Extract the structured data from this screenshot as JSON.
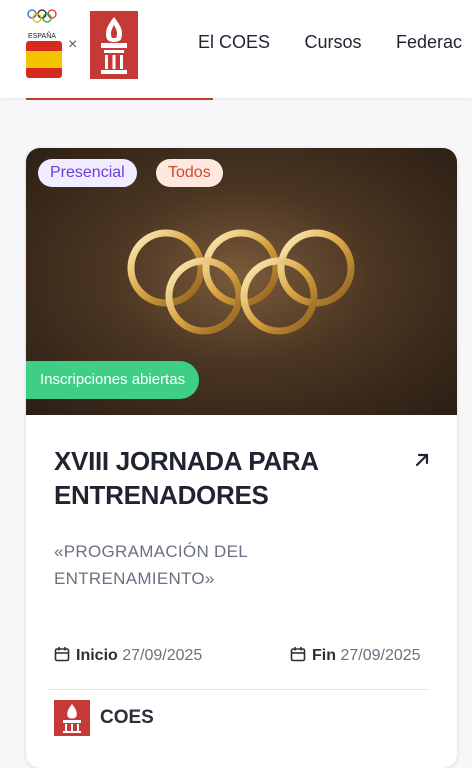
{
  "header": {
    "spain_logo_text": "ESPAÑA",
    "separator": "×",
    "nav": [
      "El COES",
      "Cursos",
      "Federac"
    ]
  },
  "card": {
    "tags": [
      "Presencial",
      "Todos"
    ],
    "status_badge": "Inscripciones abiertas",
    "title": "XVIII JORNADA PARA ENTRENADORES",
    "subtitle": "«PROGRAMACIÓN DEL ENTRENAMIENTO»",
    "start_label": "Inicio",
    "start_date": "27/09/2025",
    "end_label": "Fin",
    "end_date": "27/09/2025",
    "organizer": "COES"
  },
  "icons": {
    "external_link": "arrow-up-right-icon",
    "calendar": "calendar-icon",
    "logo_coes": "coes-torch-logo",
    "logo_spain": "spain-olympic-logo"
  },
  "colors": {
    "brand_red": "#c53a36",
    "badge_green": "#3fcf84",
    "tag_purple": "#6b3fd6",
    "tag_orange": "#d24a2a"
  }
}
